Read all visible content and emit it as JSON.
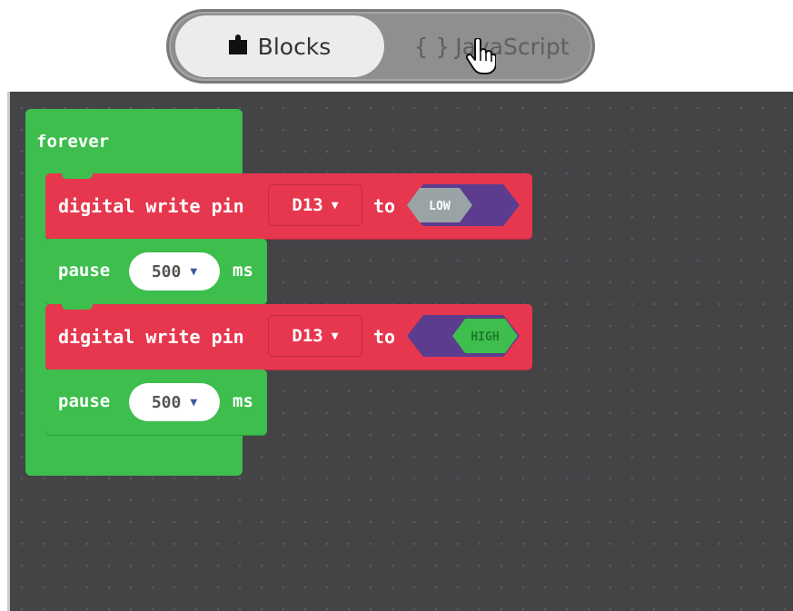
{
  "toggle": {
    "blocks_label": "Blocks",
    "javascript_label": "JavaScript",
    "js_braces": "{ }"
  },
  "workspace": {
    "forever": {
      "label": "forever"
    },
    "blocks": [
      {
        "type": "digital-write",
        "label": "digital write pin",
        "pin": "D13",
        "to_label": "to",
        "value": "LOW"
      },
      {
        "type": "pause",
        "label": "pause",
        "value": "500",
        "unit": "ms"
      },
      {
        "type": "digital-write",
        "label": "digital write pin",
        "pin": "D13",
        "to_label": "to",
        "value": "HIGH"
      },
      {
        "type": "pause",
        "label": "pause",
        "value": "500",
        "unit": "ms"
      }
    ]
  },
  "colors": {
    "workspace_bg": "#444447",
    "loop_green": "#3dbe4d",
    "pins_red": "#e6374e",
    "logic_purple": "#5c3c8e",
    "low_gray": "#9aa4a6",
    "high_green": "#3dbe4d"
  },
  "icons": {
    "blocks": "puzzle-piece-icon",
    "cursor": "hand-pointer-icon",
    "dropdown": "triangle-down-icon"
  }
}
